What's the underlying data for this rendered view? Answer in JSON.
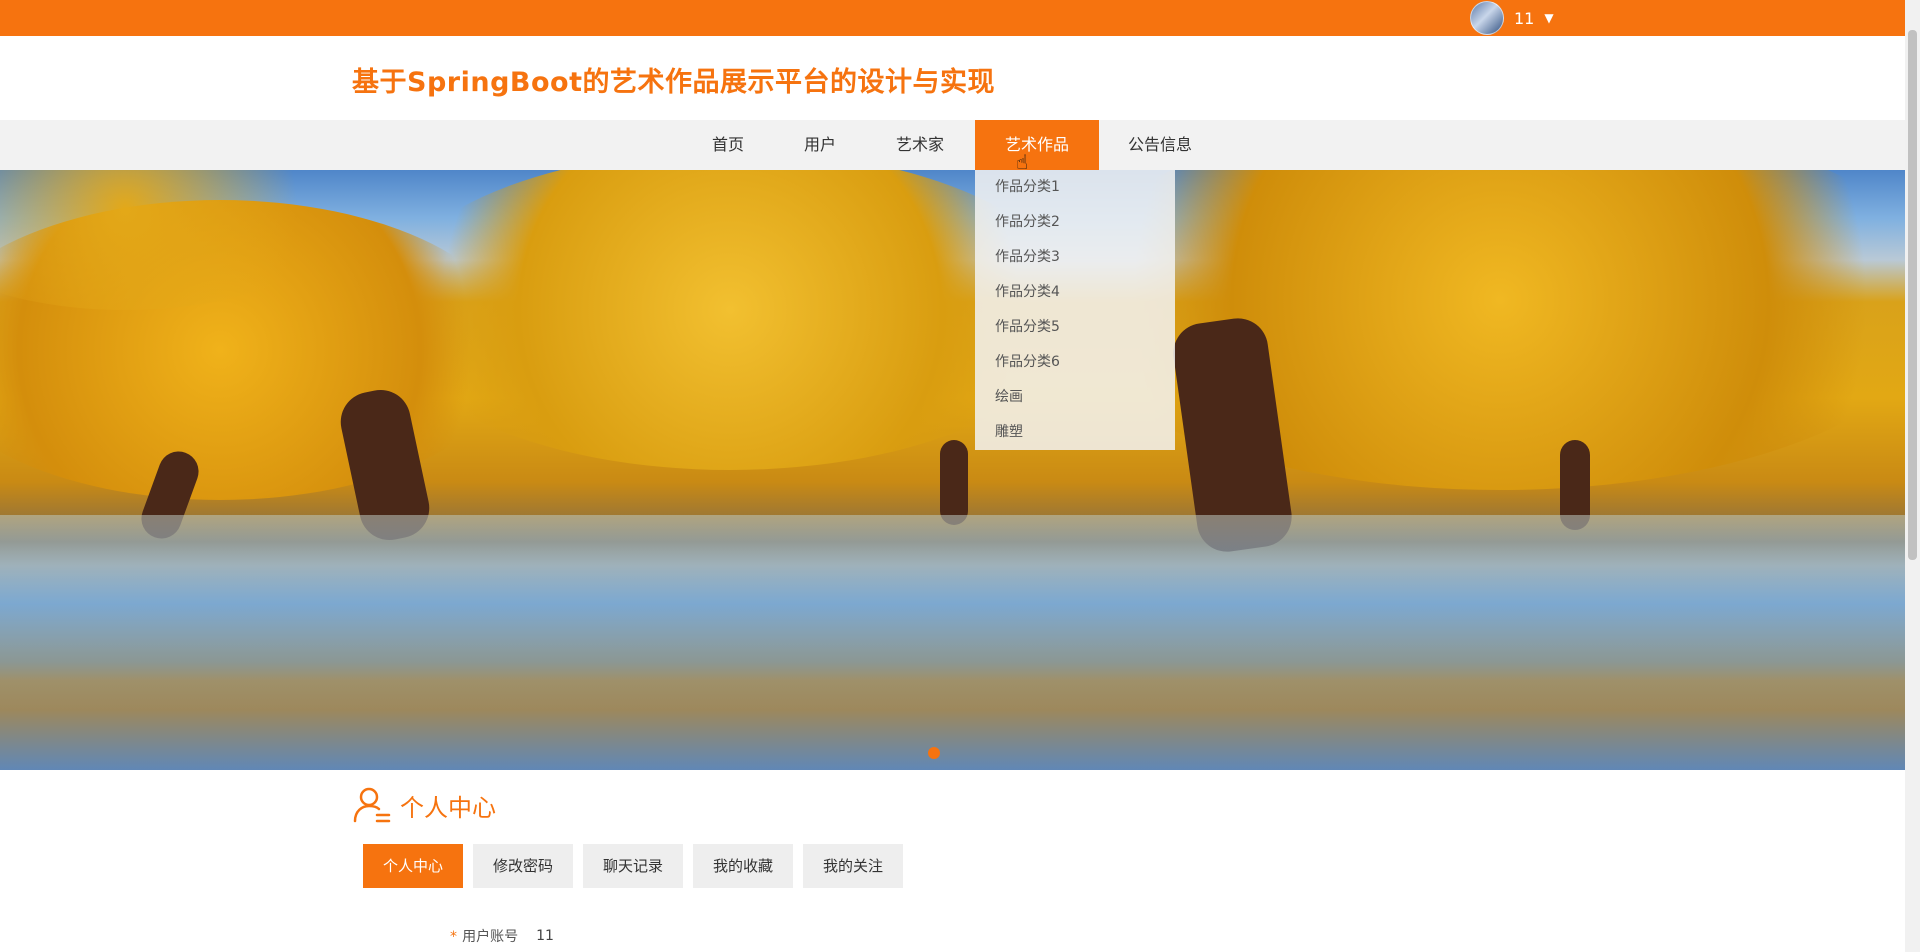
{
  "topbar": {
    "username": "11",
    "color": "#f6730f"
  },
  "site": {
    "title": "基于SpringBoot的艺术作品展示平台的设计与实现"
  },
  "nav": {
    "items": [
      {
        "label": "首页"
      },
      {
        "label": "用户"
      },
      {
        "label": "艺术家"
      },
      {
        "label": "艺术作品",
        "active": true
      },
      {
        "label": "公告信息"
      }
    ]
  },
  "dropdown": {
    "items": [
      "作品分类1",
      "作品分类2",
      "作品分类3",
      "作品分类4",
      "作品分类5",
      "作品分类6",
      "绘画",
      "雕塑"
    ]
  },
  "personal": {
    "section_title": "个人中心",
    "tabs": [
      {
        "label": "个人中心",
        "active": true
      },
      {
        "label": "修改密码"
      },
      {
        "label": "聊天记录"
      },
      {
        "label": "我的收藏"
      },
      {
        "label": "我的关注"
      }
    ],
    "form": {
      "account_label": "用户账号",
      "account_value": "11",
      "required_mark": "*"
    }
  }
}
